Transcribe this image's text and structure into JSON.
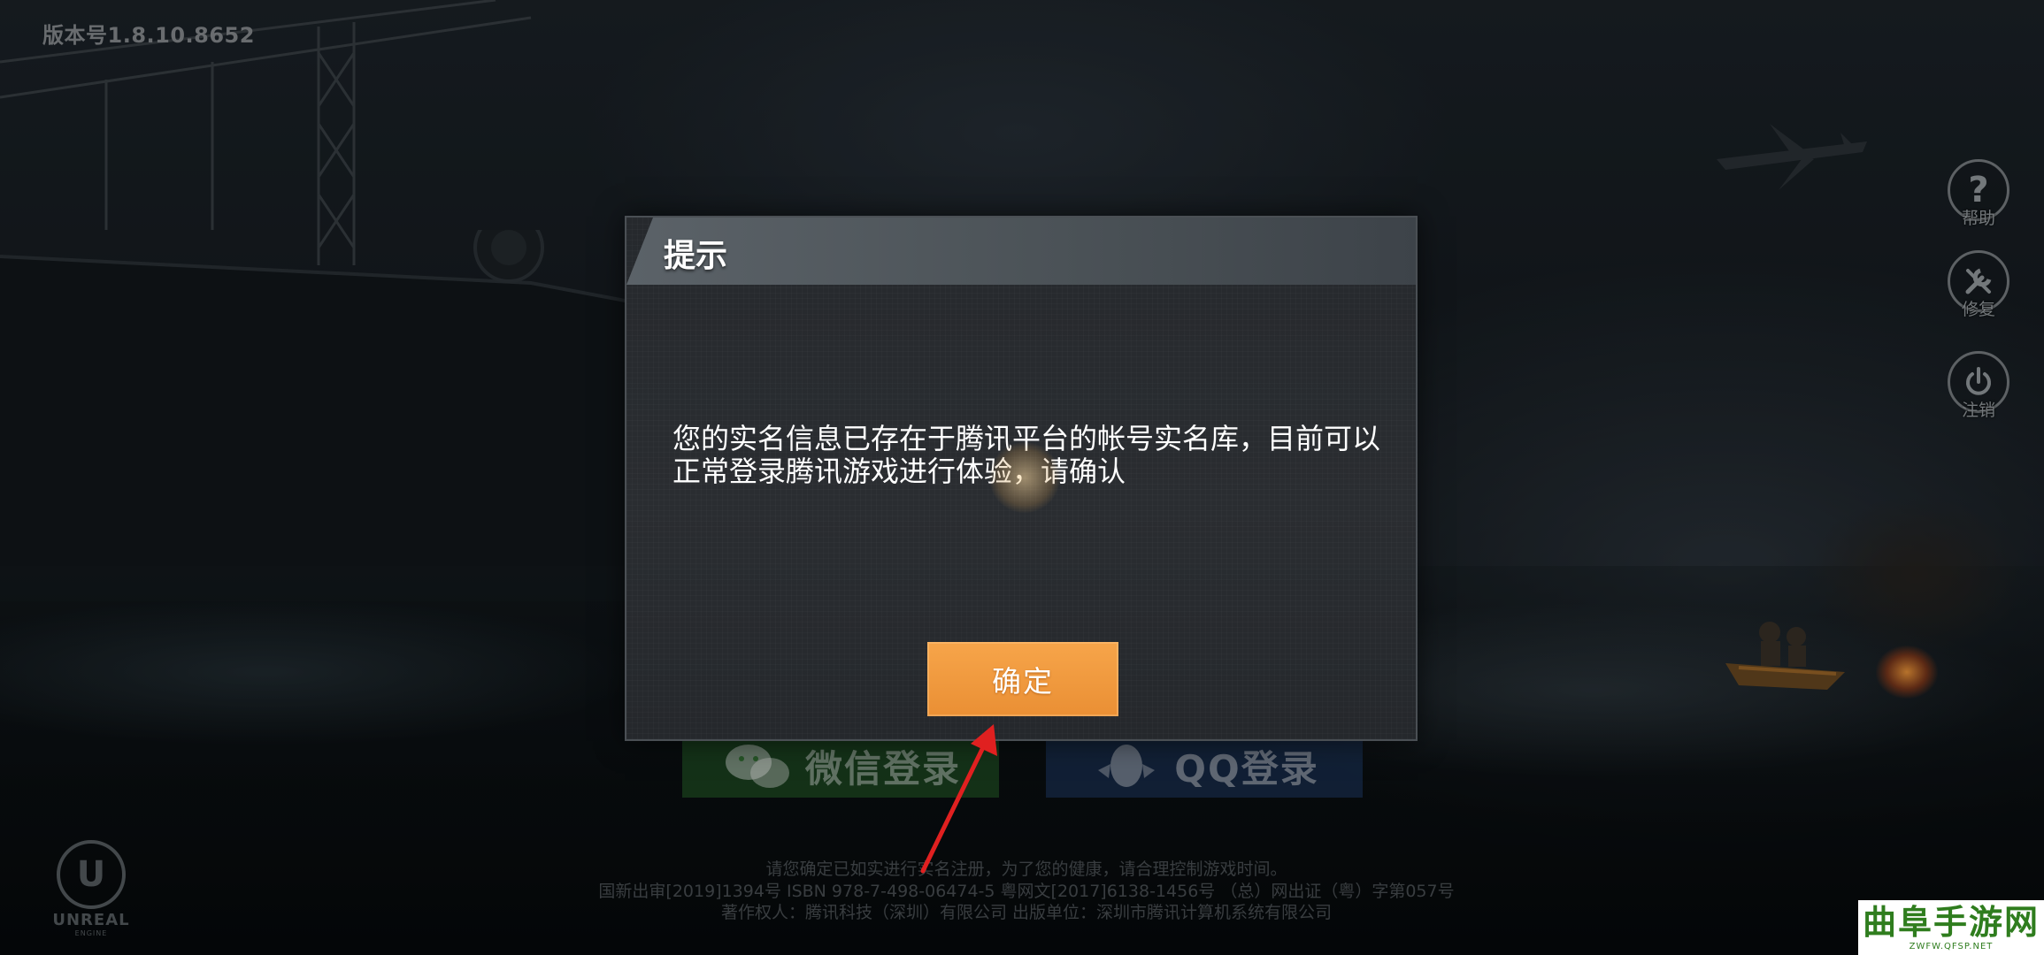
{
  "app": {
    "version_text": "版本号1.8.10.8652"
  },
  "side_menu": {
    "help_label": "帮助",
    "repair_label": "修复",
    "logout_label": "注销"
  },
  "login": {
    "wechat_label": "微信登录",
    "qq_label": "QQ登录"
  },
  "legal": {
    "line1": "请您确定已如实进行实名注册，为了您的健康，请合理控制游戏时间。",
    "line2": "国新出审[2019]1394号  ISBN 978-7-498-06474-5  粤网文[2017]6138-1456号 （总）网出证（粤）字第057号",
    "line3": "著作权人：腾讯科技（深圳）有限公司    出版单位：深圳市腾讯计算机系统有限公司"
  },
  "engine_logo": {
    "name": "UNREAL",
    "sub": "ENGINE"
  },
  "watermark": {
    "text": "曲阜手游网",
    "url": "ZWFW.QFSP.NET"
  },
  "dialog": {
    "title": "提示",
    "message": "您的实名信息已存在于腾讯平台的帐号实名库，目前可以正常登录腾讯游戏进行体验，请确认",
    "confirm_label": "确定"
  },
  "colors": {
    "confirm_button": "#f09a3f",
    "wechat_button": "#2a6e2c",
    "qq_button": "#234173",
    "watermark_green": "#2f7d1e",
    "annotation_arrow": "#e02020"
  }
}
